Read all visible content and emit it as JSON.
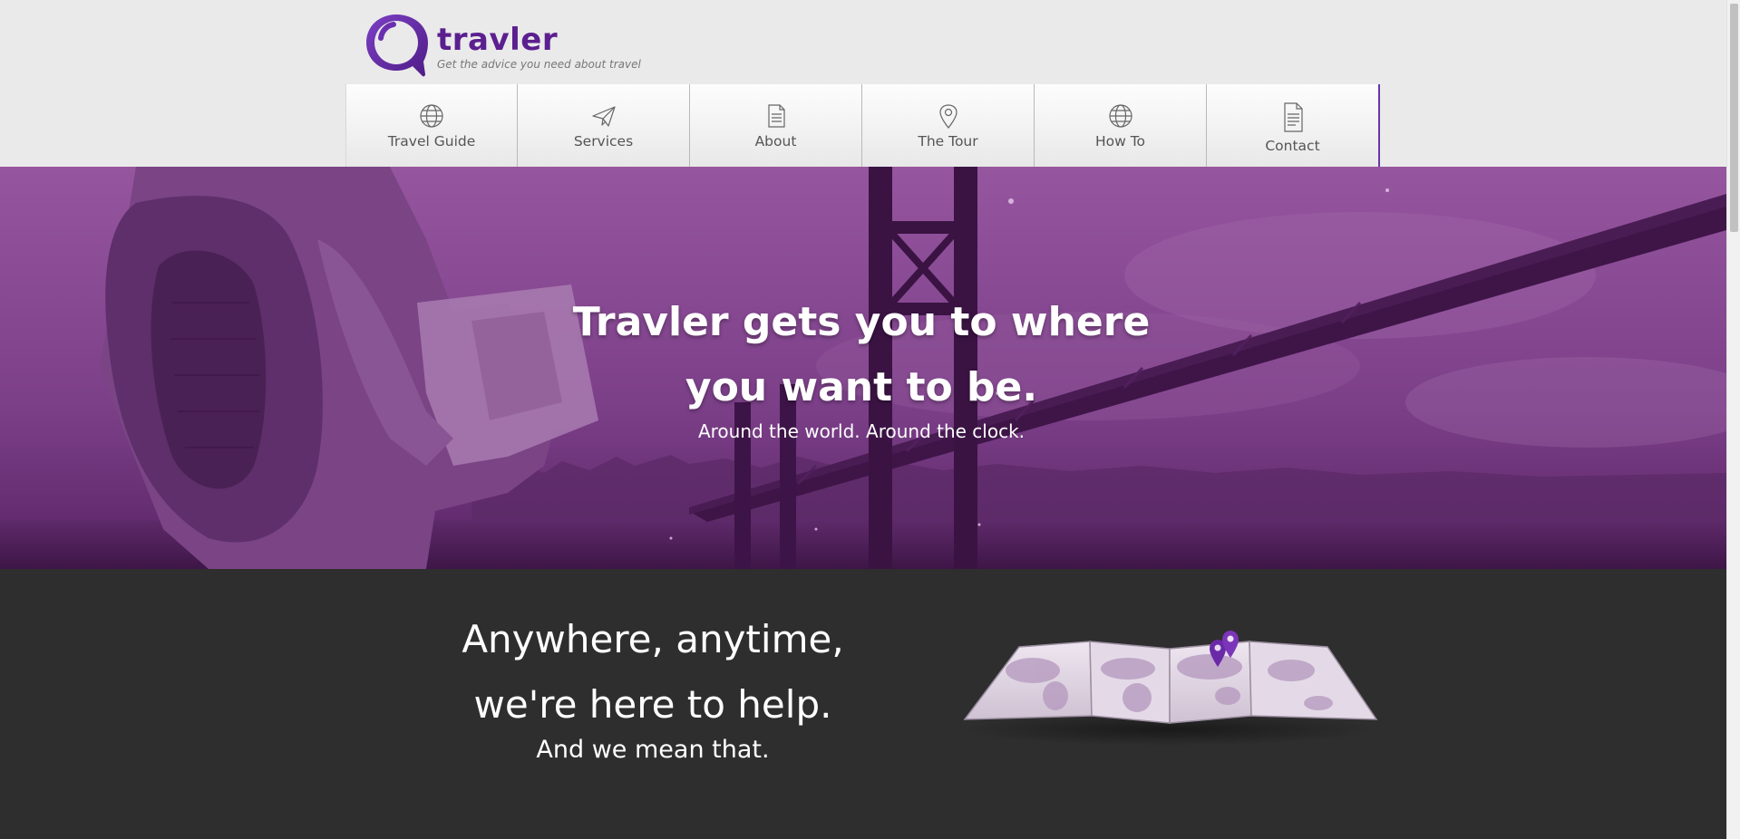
{
  "brand": {
    "name": "travler",
    "tagline": "Get the advice you need about travel",
    "color": "#5b1f8f"
  },
  "nav": {
    "items": [
      {
        "label": "Travel Guide",
        "icon": "globe-icon"
      },
      {
        "label": "Services",
        "icon": "paper-plane-icon"
      },
      {
        "label": "About",
        "icon": "document-icon"
      },
      {
        "label": "The Tour",
        "icon": "map-pin-icon"
      },
      {
        "label": "How To",
        "icon": "globe-icon"
      },
      {
        "label": "Contact",
        "icon": "document-icon"
      }
    ]
  },
  "hero": {
    "title": "Travler gets you to where you want to be.",
    "subtitle": "Around the world. Around the clock.",
    "overlay_color": "#7a3d87"
  },
  "help": {
    "title": "Anywhere, anytime, we're here to help.",
    "subtitle": "And we mean that.",
    "background": "#2e2e2e",
    "illustration": "folded-world-map-with-pins"
  }
}
